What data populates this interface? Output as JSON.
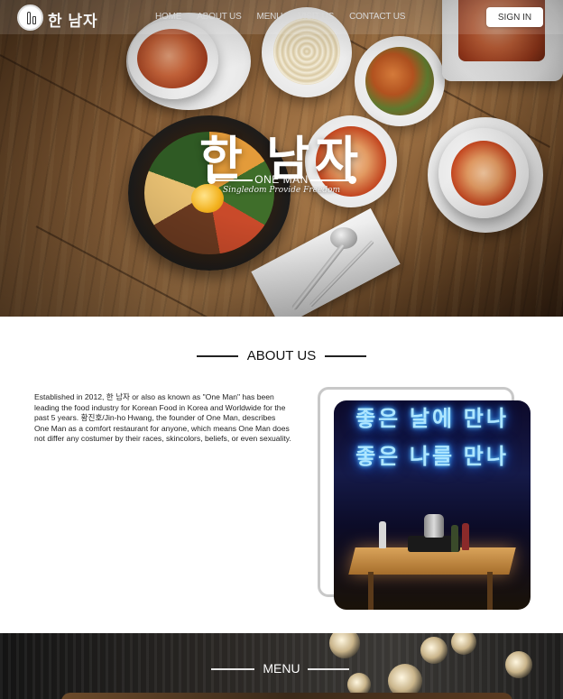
{
  "nav": {
    "logo_text": "한 남자",
    "links": [
      {
        "label": "HOME"
      },
      {
        "label": "ABOUT US"
      },
      {
        "label": "MENU"
      },
      {
        "label": "VISIT US"
      },
      {
        "label": "CONTACT US"
      }
    ],
    "signin_label": "SIGN IN"
  },
  "hero": {
    "title": "한 남자",
    "subtitle": "ONE MAN",
    "tagline": "Singledom Provide Freedom"
  },
  "about": {
    "heading": "ABOUT US",
    "paragraph": "Established in 2012, 한 남자 or also as known as \"One Man\" has been leading the food industry for Korean Food in Korea and Worldwide for the past 5 years. 황진호/Jin-ho Hwang, the founder of One Man, describes One Man as a comfort restaurant for anyone, which means One Man does not differ any costumer by their races, skincolors, beliefs, or even sexuality.",
    "neon_line_1": "좋은 날에 만나",
    "neon_line_2": "좋은 나를 만나"
  },
  "menu": {
    "heading": "MENU"
  },
  "colors": {
    "nav_text": "#d9d9d9",
    "signin_bg": "#ffffff",
    "neon": "#aee6ff",
    "menu_bg": "#2a2724"
  }
}
